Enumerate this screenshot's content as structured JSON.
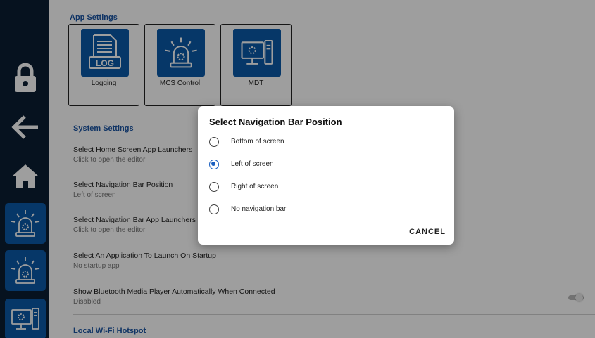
{
  "colors": {
    "nav_background": "#0b1e33",
    "app_button": "#0a5aa8",
    "section_title": "#1b55a3",
    "radio_selected": "#1a5fc0"
  },
  "nav": {
    "items": [
      {
        "name": "lock-icon"
      },
      {
        "name": "back-arrow-icon"
      },
      {
        "name": "home-icon"
      },
      {
        "name": "siren-icon"
      },
      {
        "name": "siren-icon"
      },
      {
        "name": "computer-icon"
      }
    ]
  },
  "app_settings": {
    "title": "App Settings",
    "tiles": [
      {
        "label": "Logging",
        "icon": "log-document-icon"
      },
      {
        "label": "MCS Control",
        "icon": "siren-icon"
      },
      {
        "label": "MDT",
        "icon": "computer-icon"
      }
    ]
  },
  "system_settings": {
    "title": "System Settings",
    "rows": [
      {
        "title": "Select Home Screen App Launchers",
        "subtitle": "Click to open the editor"
      },
      {
        "title": "Select Navigation Bar Position",
        "subtitle": "Left of screen"
      },
      {
        "title": "Select Navigation Bar App Launchers",
        "subtitle": "Click to open the editor"
      },
      {
        "title": "Select An Application To Launch On Startup",
        "subtitle": "No startup app"
      },
      {
        "title": "Show Bluetooth Media Player Automatically When Connected",
        "subtitle": "Disabled",
        "toggle_on": false
      }
    ]
  },
  "hotspot": {
    "title": "Local Wi-Fi Hotspot"
  },
  "dialog": {
    "title": "Select Navigation Bar Position",
    "options": [
      {
        "label": "Bottom of screen",
        "selected": false
      },
      {
        "label": "Left of screen",
        "selected": true
      },
      {
        "label": "Right of screen",
        "selected": false
      },
      {
        "label": "No navigation bar",
        "selected": false
      }
    ],
    "cancel_label": "CANCEL"
  }
}
